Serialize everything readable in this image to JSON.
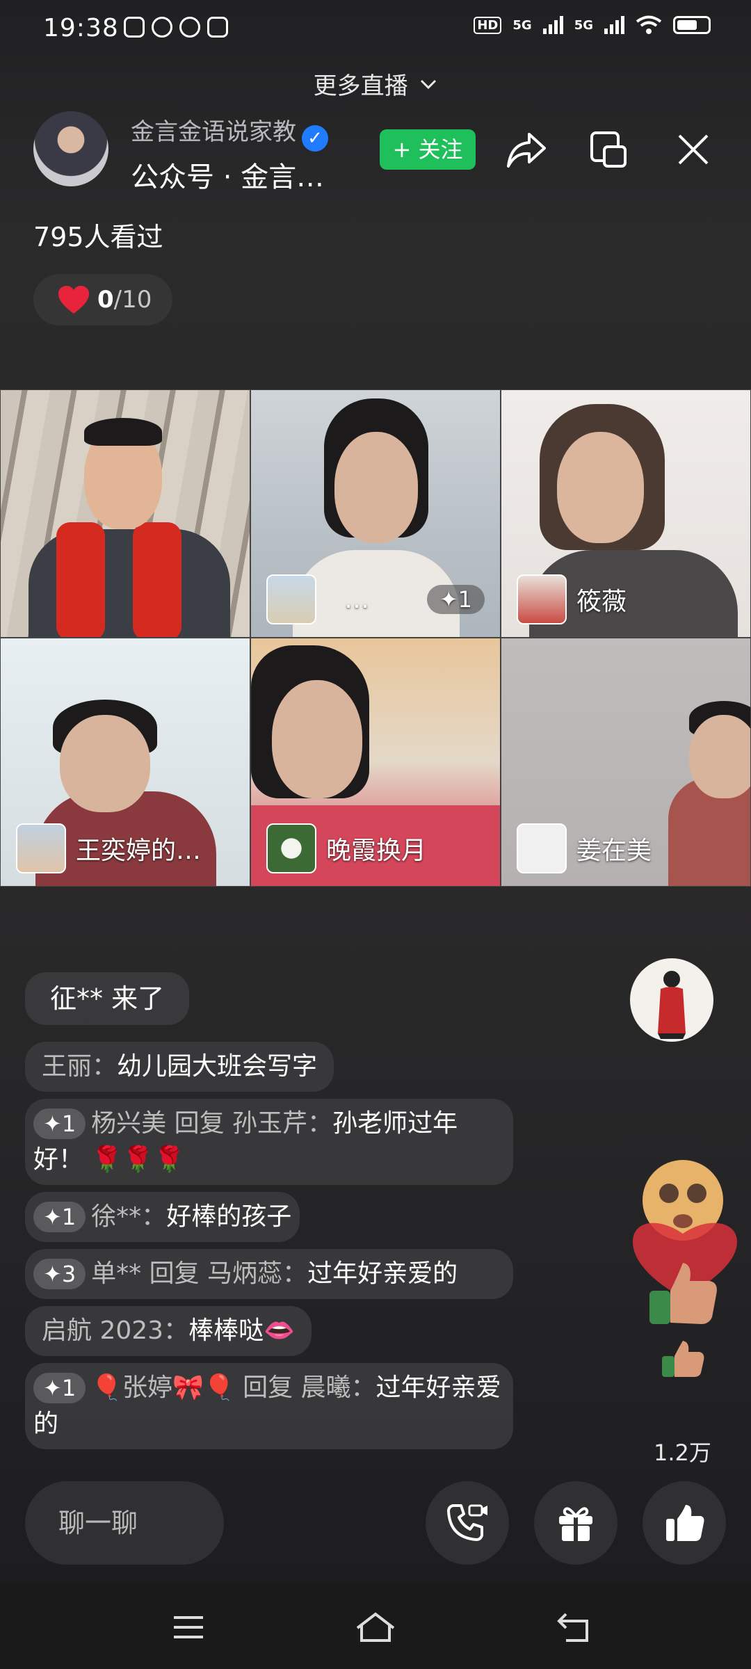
{
  "status_bar": {
    "time": "19:38",
    "app_icons": [
      "scissor-app-icon",
      "wechat-icon",
      "video-app-icon",
      "browser-icon"
    ],
    "hd_label": "HD",
    "net1": "5G",
    "net2": "5G"
  },
  "header": {
    "more_live": "更多直播",
    "host_name": "金言金语说家教",
    "host_subtitle": "公众号 · 金言…",
    "follow_label": "+ 关注",
    "viewers": "795人看过",
    "likes_current": "0",
    "likes_total": "/10"
  },
  "grid": {
    "tiles": [
      {
        "name": "",
        "extra": ""
      },
      {
        "name": "…",
        "extra": "✦1"
      },
      {
        "name": "筱薇",
        "extra": ""
      },
      {
        "name": "王奕婷的…",
        "extra": ""
      },
      {
        "name": "晚霞换月",
        "extra": ""
      },
      {
        "name": "姜在美",
        "extra": ""
      }
    ]
  },
  "chat": {
    "join_notice": "征** 来了",
    "messages": [
      {
        "badge": "",
        "nick": "王丽：",
        "text": "幼儿园大班会写字"
      },
      {
        "badge": "✦1",
        "nick": "杨兴美 回复 孙玉芹：",
        "text": "孙老师过年好！ 🌹🌹🌹"
      },
      {
        "badge": "✦1",
        "nick": "徐**：",
        "text": "好棒的孩子"
      },
      {
        "badge": "✦3",
        "nick": "单** 回复 马炳蕊：",
        "text": "过年好亲爱的"
      },
      {
        "badge": "",
        "nick": "启航 2023：",
        "text": "棒棒哒👄"
      },
      {
        "badge": "✦1",
        "nick": "🎈张婷🎀🎈 回复 晨曦：",
        "text": "过年好亲爱的"
      }
    ]
  },
  "side": {
    "like_count": "1.2万"
  },
  "bottom": {
    "chat_placeholder": "聊一聊"
  },
  "colors": {
    "follow_green": "#1fbf5c",
    "verified_blue": "#1f7cff",
    "heart_red": "#e8243c"
  }
}
